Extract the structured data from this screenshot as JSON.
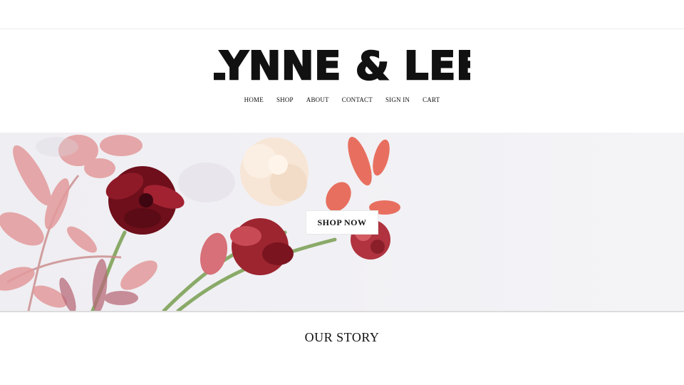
{
  "brand": {
    "name": "LYNNE & LEE"
  },
  "nav": {
    "items": [
      {
        "label": "HOME"
      },
      {
        "label": "SHOP"
      },
      {
        "label": "ABOUT"
      },
      {
        "label": "CONTACT"
      },
      {
        "label": "SIGN IN"
      },
      {
        "label": "CART"
      }
    ]
  },
  "hero": {
    "cta_label": "SHOP NOW"
  },
  "sections": {
    "story_title": "OUR STORY"
  },
  "colors": {
    "hero_background": "#efeef2",
    "petal_pink": "#e8808a",
    "deep_red": "#7a0f1c",
    "cream": "#f7e6d6",
    "stem_green": "#7fa35a"
  }
}
